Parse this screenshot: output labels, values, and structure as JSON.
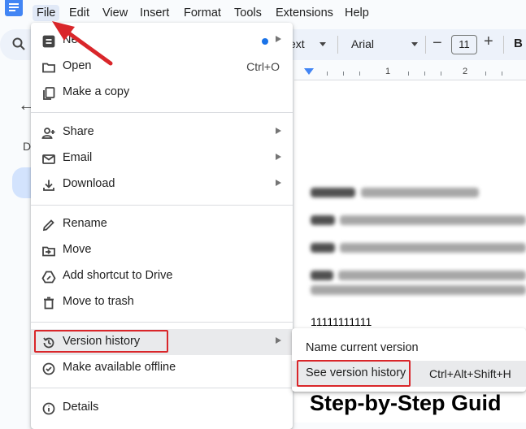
{
  "menubar": {
    "items": [
      "File",
      "Edit",
      "View",
      "Insert",
      "Format",
      "Tools",
      "Extensions",
      "Help"
    ]
  },
  "toolbar": {
    "style_partial": "ext",
    "font": "Arial",
    "font_size": "11",
    "bold_label": "B"
  },
  "ruler": {
    "numbers": [
      "1",
      "2"
    ]
  },
  "outline": {
    "letter": "D"
  },
  "file_menu": {
    "new": {
      "label": "New",
      "label_visible": "Ne",
      "icon": "new-doc-icon"
    },
    "open": {
      "label": "Open",
      "shortcut": "Ctrl+O",
      "icon": "folder-icon"
    },
    "copy": {
      "label": "Make a copy",
      "icon": "copy-icon"
    },
    "share": {
      "label": "Share",
      "icon": "person-add-icon"
    },
    "email": {
      "label": "Email",
      "icon": "mail-icon"
    },
    "download": {
      "label": "Download",
      "icon": "download-icon"
    },
    "rename": {
      "label": "Rename",
      "icon": "pencil-icon"
    },
    "move": {
      "label": "Move",
      "icon": "folder-move-icon"
    },
    "shortcut": {
      "label": "Add shortcut to Drive",
      "icon": "drive-shortcut-icon"
    },
    "trash": {
      "label": "Move to trash",
      "icon": "trash-icon"
    },
    "version": {
      "label": "Version history",
      "icon": "history-icon"
    },
    "offline": {
      "label": "Make available offline",
      "icon": "offline-check-icon"
    },
    "details": {
      "label": "Details",
      "icon": "info-icon"
    }
  },
  "version_submenu": {
    "name_current": "Name current version",
    "see_history": "See version history",
    "see_history_shortcut": "Ctrl+Alt+Shift+H"
  },
  "document": {
    "typed_text": "11111111111",
    "heading_partial": "Step-by-Step Guid"
  },
  "colors": {
    "highlight_box": "#d9262a",
    "accent_blue": "#1a73e8",
    "menu_hover": "#e9eaec"
  }
}
